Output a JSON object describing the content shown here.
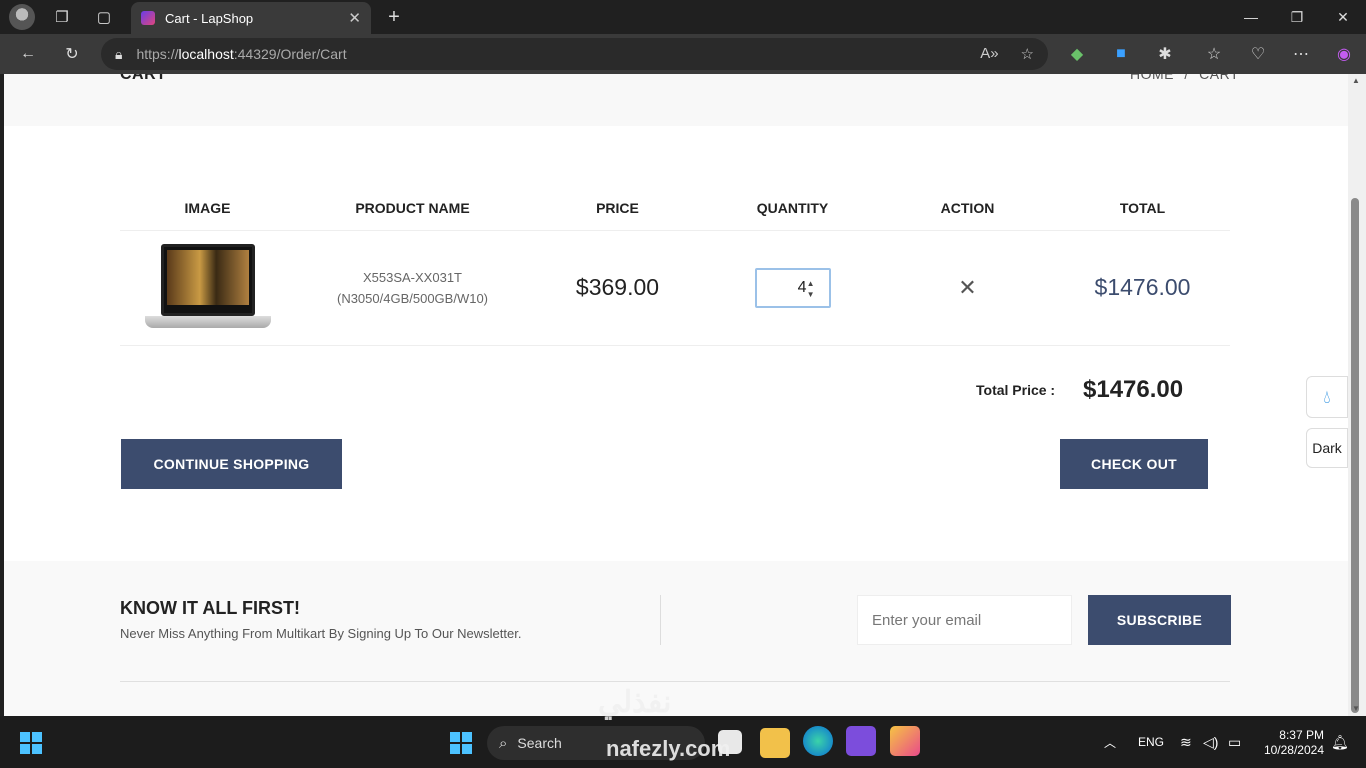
{
  "browser": {
    "tab_title": "Cart - LapShop",
    "url_prefix": "https://",
    "url_host": "localhost",
    "url_rest": ":44329/Order/Cart"
  },
  "page": {
    "title": "CART",
    "breadcrumb": [
      "HOME",
      "/",
      "CART"
    ]
  },
  "cart": {
    "columns": [
      "IMAGE",
      "PRODUCT NAME",
      "PRICE",
      "QUANTITY",
      "ACTION",
      "TOTAL"
    ],
    "items": [
      {
        "name_line1": "X553SA-XX031T",
        "name_line2": "(N3050/4GB/500GB/W10)",
        "price": "$369.00",
        "quantity": "4",
        "total": "$1476.00"
      }
    ],
    "total_label": "Total Price :",
    "total_value": "$1476.00",
    "continue_label": "CONTINUE SHOPPING",
    "checkout_label": "CHECK OUT"
  },
  "newsletter": {
    "title": "KNOW IT ALL FIRST!",
    "subtitle": "Never Miss Anything From Multikart By Signing Up To Our Newsletter.",
    "email_placeholder": "Enter your email",
    "subscribe_label": "SUBSCRIBE"
  },
  "side": {
    "dark_label": "Dark"
  },
  "taskbar": {
    "search_label": "Search",
    "lang": "ENG",
    "time": "8:37 PM",
    "date": "10/28/2024"
  },
  "watermark": {
    "arabic": "نفذلي",
    "latin": "nafezly.com"
  },
  "colors": {
    "button": "#3c4c6e",
    "accent": "#4cc2ff"
  }
}
